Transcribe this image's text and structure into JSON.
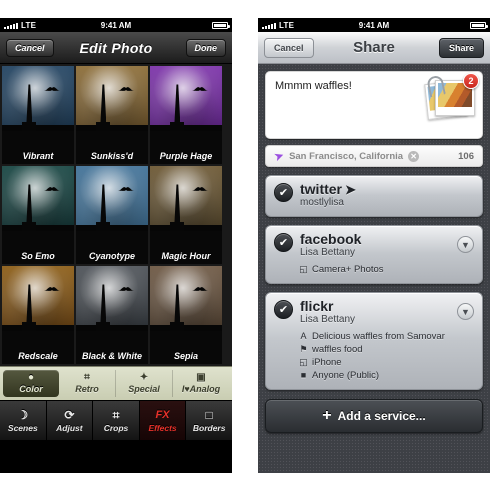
{
  "status_bar": {
    "carrier": "LTE",
    "time": "9:41 AM"
  },
  "left_screen": {
    "nav": {
      "cancel": "Cancel",
      "title": "Edit Photo",
      "done": "Done"
    },
    "filters": [
      {
        "name": "Vibrant",
        "sky_top": "#1d3f5e",
        "sky_bottom": "#0d2133",
        "accent": "#5f93b8"
      },
      {
        "name": "Sunkiss'd",
        "sky_top": "#8a6a33",
        "sky_bottom": "#3a2a12",
        "accent": "#d8b468"
      },
      {
        "name": "Purple Hage",
        "sky_top": "#7a2fa8",
        "sky_bottom": "#3a0f5a",
        "accent": "#c77ce8"
      },
      {
        "name": "So Emo",
        "sky_top": "#13423f",
        "sky_bottom": "#061a1c",
        "accent": "#3c8d88"
      },
      {
        "name": "Cyanotype",
        "sky_top": "#3d6f96",
        "sky_bottom": "#24465f",
        "accent": "#8fbcd8"
      },
      {
        "name": "Magic Hour",
        "sky_top": "#6a5530",
        "sky_bottom": "#2b2415",
        "accent": "#d8b86a"
      },
      {
        "name": "Redscale",
        "sky_top": "#8a5a12",
        "sky_bottom": "#3a1f05",
        "accent": "#e8a83a"
      },
      {
        "name": "Black & White",
        "sky_top": "#4a4f55",
        "sky_bottom": "#12161a",
        "accent": "#cfd4d8"
      },
      {
        "name": "Sepia",
        "sky_top": "#6b5540",
        "sky_bottom": "#2a2016",
        "accent": "#cbb08a"
      }
    ],
    "categories": [
      {
        "label": "Color",
        "icon": "color-circles-icon",
        "glyph": "●",
        "active": true
      },
      {
        "label": "Retro",
        "icon": "retro-camera-icon",
        "glyph": "⌗",
        "active": false
      },
      {
        "label": "Special",
        "icon": "magic-wand-icon",
        "glyph": "✦",
        "active": false
      },
      {
        "label": "I♥Analog",
        "icon": "film-camera-icon",
        "glyph": "▣",
        "active": false
      }
    ],
    "tabs": [
      {
        "label": "Scenes",
        "icon": "scenes-icon",
        "glyph": "☽",
        "active": false
      },
      {
        "label": "Adjust",
        "icon": "adjust-icon",
        "glyph": "⟳",
        "active": false
      },
      {
        "label": "Crops",
        "icon": "crop-icon",
        "glyph": "⌗",
        "active": false
      },
      {
        "label": "Effects",
        "icon": "fx-icon",
        "glyph": "FX",
        "active": true
      },
      {
        "label": "Borders",
        "icon": "borders-icon",
        "glyph": "□",
        "active": false
      }
    ]
  },
  "right_screen": {
    "nav": {
      "cancel": "Cancel",
      "title": "Share",
      "share": "Share"
    },
    "compose": {
      "text": "Mmmm waffles!",
      "photo_badge": "2"
    },
    "location": {
      "value": "San Francisco, California",
      "clear": "✕",
      "char_count": "106"
    },
    "services": [
      {
        "name": "twitter",
        "user": "mostlylisa",
        "checked": true,
        "logo_bird": "🐦",
        "has_chevron": false,
        "details": []
      },
      {
        "name": "facebook",
        "user": "Lisa Bettany",
        "checked": true,
        "has_chevron": true,
        "details": [
          {
            "icon": "album-icon",
            "glyph": "◱",
            "text": "Camera+ Photos"
          }
        ]
      },
      {
        "name": "flickr",
        "user": "Lisa Bettany",
        "checked": true,
        "has_chevron": true,
        "details": [
          {
            "icon": "title-icon",
            "glyph": "A",
            "text": "Delicious waffles from Samovar"
          },
          {
            "icon": "tag-icon",
            "glyph": "⚑",
            "text": "waffles food"
          },
          {
            "icon": "album-icon",
            "glyph": "◱",
            "text": "iPhone"
          },
          {
            "icon": "lock-icon",
            "glyph": "■",
            "text": "Anyone (Public)"
          }
        ]
      }
    ],
    "add_service": {
      "plus": "+",
      "label": "Add a service..."
    }
  },
  "colors": {
    "accent_red": "#e8312a",
    "badge_red": "#c8261c",
    "loc_purple": "#9b4fe0"
  }
}
